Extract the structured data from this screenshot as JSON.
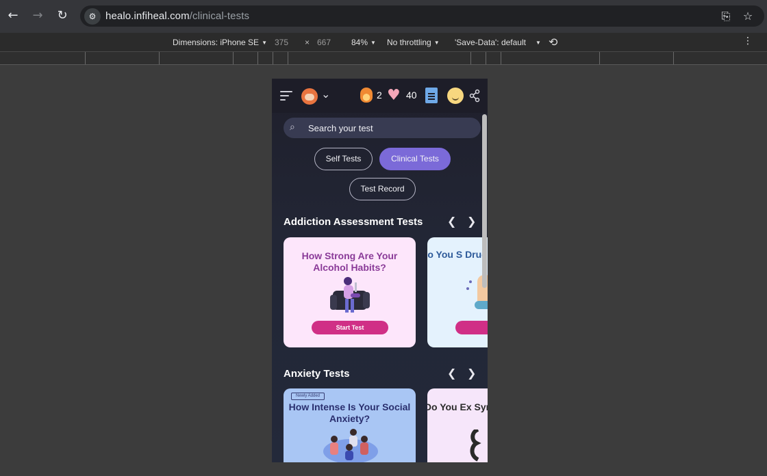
{
  "browser": {
    "url_domain": "healo.infiheal.com",
    "url_path": "/clinical-tests"
  },
  "devtools": {
    "dimensions_label": "Dimensions: iPhone SE",
    "width": "375",
    "times": "×",
    "height": "667",
    "zoom": "84%",
    "throttling": "No throttling",
    "save_data": "'Save-Data': default"
  },
  "app": {
    "streak_count": "2",
    "hearts_count": "40",
    "search_placeholder": "Search your test",
    "tabs": [
      {
        "label": "Self Tests",
        "active": false
      },
      {
        "label": "Clinical Tests",
        "active": true
      },
      {
        "label": "Test Record",
        "active": false
      }
    ],
    "sections": [
      {
        "title": "Addiction Assessment Tests",
        "cards": [
          {
            "title": "How Strong Are Your Alcohol Habits?",
            "button": "Start Test",
            "bg": "#fde6fb",
            "title_color": "#8a3a98"
          },
          {
            "title": "Do You S Drug D",
            "button": "S",
            "bg": "#e4f2fd",
            "title_color": "#2d5a9a"
          }
        ]
      },
      {
        "title": "Anxiety Tests",
        "cards": [
          {
            "badge": "Newly Added",
            "title": "How Intense Is Your Social Anxiety?",
            "bg": "#a9c6f4",
            "title_color": "#2a2f6e"
          },
          {
            "title": "Do You Ex Sym",
            "bg": "#f6e6fa",
            "title_color": "#2a2a2a"
          }
        ]
      }
    ]
  }
}
